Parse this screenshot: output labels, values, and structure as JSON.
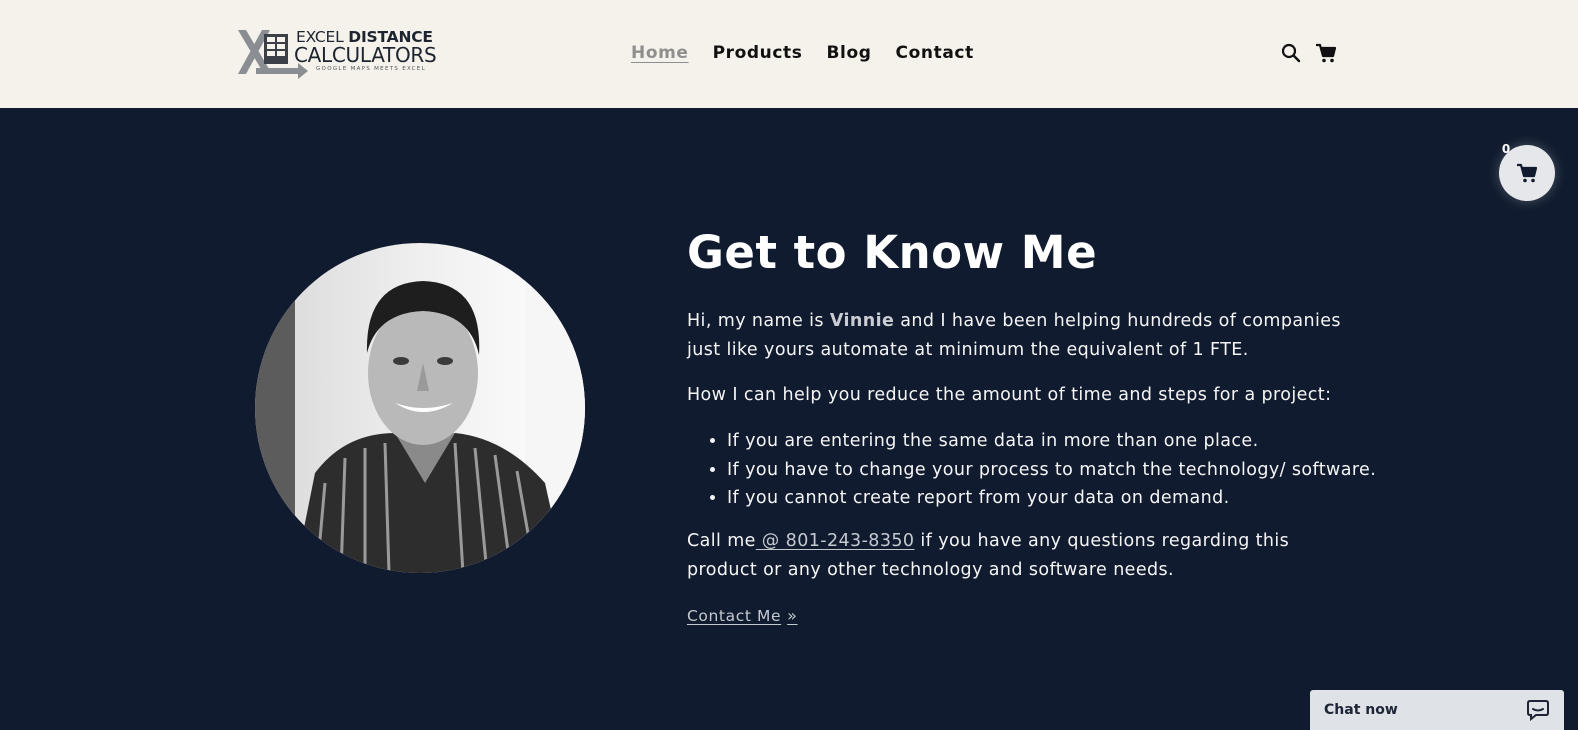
{
  "header": {
    "logo": {
      "line1a": "EXCEL",
      "line1b": "DISTANCE",
      "line2": "CALCULATORS",
      "tagline": "GOOGLE MAPS MEETS EXCEL"
    },
    "nav": [
      {
        "label": "Home",
        "active": true
      },
      {
        "label": "Products",
        "active": false
      },
      {
        "label": "Blog",
        "active": false
      },
      {
        "label": "Contact",
        "active": false
      }
    ],
    "icons": [
      "search-icon",
      "cart-icon"
    ]
  },
  "main": {
    "title": "Get to Know Me",
    "intro_prefix": "Hi, my name is ",
    "intro_name": "Vinnie",
    "intro_suffix": " and I have been helping hundreds of companies just like yours automate at minimum the equivalent of 1 FTE.",
    "help_heading": "How I can help you reduce the amount of time and steps for a project:",
    "bullets": [
      "If you are entering the same data in more than one place.",
      "If you have to change your process to match the technology/ software.",
      "If you cannot create report from your data on demand."
    ],
    "call_prefix": "Call me",
    "call_phone": " @ 801-243-8350",
    "call_suffix": " if you have any questions regarding this product or any other technology and software needs.",
    "contact_link": "Contact Me"
  },
  "floating_cart": {
    "count": "0",
    "icon": "cart-icon"
  },
  "chat": {
    "label": "Chat now",
    "icon": "chat-bubble-icon"
  },
  "colors": {
    "header_bg": "#f4f2ea",
    "page_bg": "#101b2f",
    "text": "#ffffff",
    "accent_muted": "#8f8f8f"
  }
}
